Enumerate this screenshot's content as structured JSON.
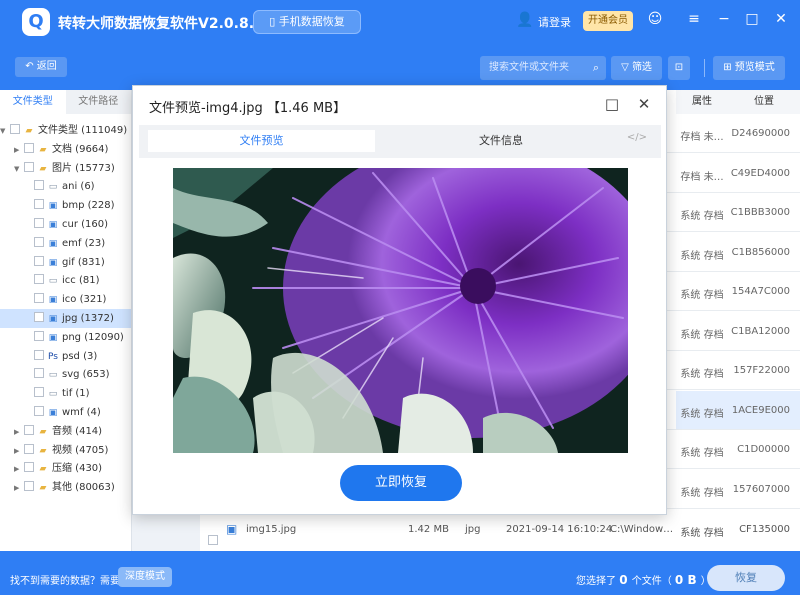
{
  "app": {
    "title": "转转大师数据恢复软件V2.0.8.9",
    "phone_recovery": "手机数据恢复",
    "login": "请登录",
    "vip": "开通会员"
  },
  "toolbar": {
    "back": "返回",
    "search_placeholder": "搜索文件或文件夹",
    "filter": "筛选",
    "preview_mode": "预览模式"
  },
  "sidebar": {
    "tabs": [
      "文件类型",
      "文件路径"
    ],
    "tree": [
      {
        "label": "文件类型 (111049)",
        "icon": "folder"
      },
      {
        "label": "文档 (9664)",
        "icon": "folder"
      },
      {
        "label": "图片 (15773)",
        "icon": "folder"
      },
      {
        "label": "ani (6)",
        "icon": "file"
      },
      {
        "label": "bmp (228)",
        "icon": "image-file"
      },
      {
        "label": "cur (160)",
        "icon": "image-file"
      },
      {
        "label": "emf (23)",
        "icon": "image-file"
      },
      {
        "label": "gif (831)",
        "icon": "image-file"
      },
      {
        "label": "icc (81)",
        "icon": "file"
      },
      {
        "label": "ico (321)",
        "icon": "image-file"
      },
      {
        "label": "jpg (1372)",
        "icon": "image-file"
      },
      {
        "label": "png (12090)",
        "icon": "image-file"
      },
      {
        "label": "psd (3)",
        "icon": "ps-file"
      },
      {
        "label": "svg (653)",
        "icon": "file"
      },
      {
        "label": "tif (1)",
        "icon": "file"
      },
      {
        "label": "wmf (4)",
        "icon": "image-file"
      },
      {
        "label": "音频 (414)",
        "icon": "folder"
      },
      {
        "label": "视频 (4705)",
        "icon": "folder"
      },
      {
        "label": "压缩 (430)",
        "icon": "folder"
      },
      {
        "label": "其他 (80063)",
        "icon": "folder"
      }
    ]
  },
  "table": {
    "headers": {
      "attr": "属性",
      "pos": "位置"
    },
    "rows": [
      {
        "attr": "存档 未…",
        "pos": "D24690000"
      },
      {
        "attr": "存档 未…",
        "pos": "C49ED4000"
      },
      {
        "attr": "系统 存档",
        "pos": "C1BBB3000"
      },
      {
        "attr": "系统 存档",
        "pos": "C1B856000"
      },
      {
        "attr": "系统 存档",
        "pos": "154A7C000"
      },
      {
        "attr": "系统 存档",
        "pos": "C1BA12000"
      },
      {
        "attr": "系统 存档",
        "pos": "157F22000"
      },
      {
        "attr": "系统 存档",
        "pos": "1ACE9E000"
      },
      {
        "attr": "系统 存档",
        "pos": "C1D00000"
      },
      {
        "attr": "系统 存档",
        "pos": "157607000"
      }
    ],
    "last_row": {
      "name": "img15.jpg",
      "size": "1.42 MB",
      "type": "jpg",
      "date": "2021-09-14 16:10:24",
      "path": "C:\\Window…",
      "attr": "系统 存档",
      "pos": "CF135000"
    }
  },
  "dialog": {
    "title": "文件预览-img4.jpg 【1.46 MB】",
    "tab_preview": "文件预览",
    "tab_info": "文件信息",
    "code_icon": "</>",
    "recover_button": "立即恢复"
  },
  "bottom": {
    "help_text": "找不到需要的数据？需要",
    "deep_mode": "深度模式",
    "selection_prefix": "您选择了",
    "selection_count": "0",
    "selection_mid": "个文件（",
    "selection_size": "0 B",
    "selection_suffix": "）",
    "recover": "恢复"
  },
  "colors": {
    "brand": "#2f7ef4",
    "dialog_button": "#1f77ee"
  }
}
